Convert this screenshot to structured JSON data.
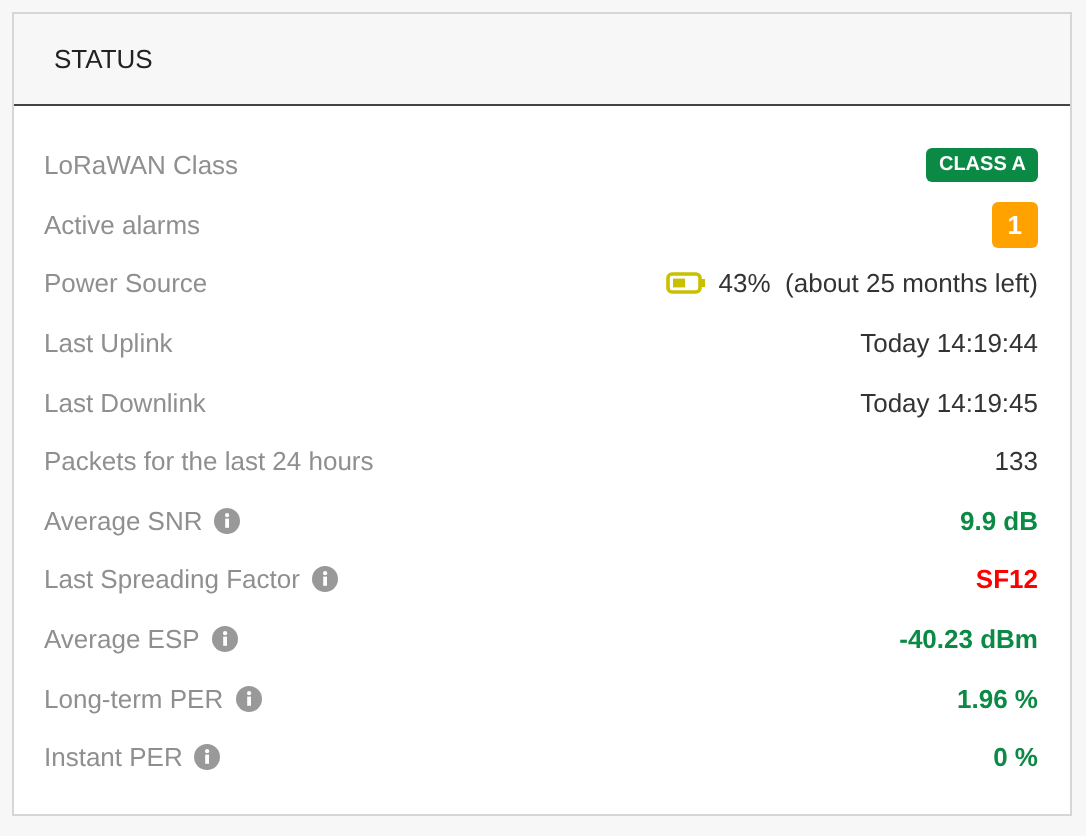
{
  "panel": {
    "title": "STATUS"
  },
  "rows": [
    {
      "label": "LoRaWAN Class",
      "kind": "badge",
      "value": "CLASS A",
      "color": "#0a8a44",
      "info": false
    },
    {
      "label": "Active alarms",
      "kind": "badge",
      "value": "1",
      "color": "#ffa200",
      "info": false
    },
    {
      "label": "Power Source",
      "kind": "battery",
      "value": "43%  (about 25 months left)",
      "info": false
    },
    {
      "label": "Last Uplink",
      "kind": "text",
      "value": "Today 14:19:44",
      "info": false
    },
    {
      "label": "Last Downlink",
      "kind": "text",
      "value": "Today 14:19:45",
      "info": false
    },
    {
      "label": "Packets for the last 24 hours",
      "kind": "text",
      "value": "133",
      "info": false
    },
    {
      "label": "Average SNR",
      "kind": "metric",
      "value": "9.9 dB",
      "color": "#0a8a44",
      "info": true
    },
    {
      "label": "Last Spreading Factor",
      "kind": "metric",
      "value": "SF12",
      "color": "#ff0000",
      "info": true
    },
    {
      "label": "Average ESP",
      "kind": "metric",
      "value": "-40.23 dBm",
      "color": "#0a8a44",
      "info": true
    },
    {
      "label": "Long-term PER",
      "kind": "metric",
      "value": "1.96 %",
      "color": "#0a8a44",
      "info": true
    },
    {
      "label": "Instant PER",
      "kind": "metric",
      "value": "0 %",
      "color": "#0a8a44",
      "info": true
    }
  ]
}
